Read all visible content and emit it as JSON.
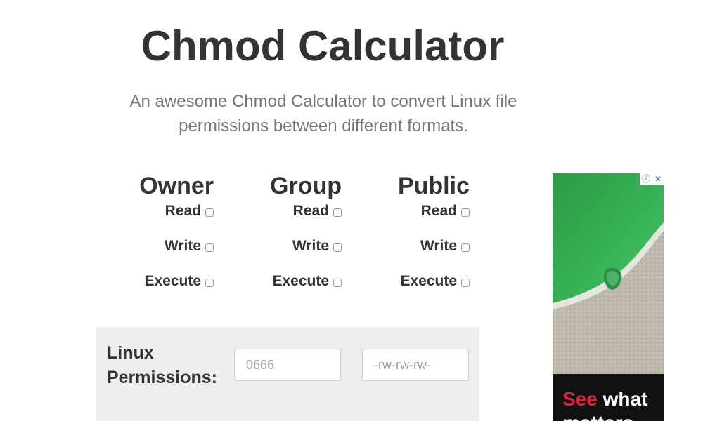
{
  "header": {
    "title": "Chmod Calculator",
    "subtitle": "An awesome Chmod Calculator to convert Linux file permissions between different formats."
  },
  "permissions": {
    "columns": [
      {
        "heading": "Owner",
        "rows": [
          {
            "label": "Read",
            "checked": false
          },
          {
            "label": "Write",
            "checked": false
          },
          {
            "label": "Execute",
            "checked": false
          }
        ]
      },
      {
        "heading": "Group",
        "rows": [
          {
            "label": "Read",
            "checked": false
          },
          {
            "label": "Write",
            "checked": false
          },
          {
            "label": "Execute",
            "checked": false
          }
        ]
      },
      {
        "heading": "Public",
        "rows": [
          {
            "label": "Read",
            "checked": false
          },
          {
            "label": "Write",
            "checked": false
          },
          {
            "label": "Execute",
            "checked": false
          }
        ]
      }
    ]
  },
  "linux_permissions": {
    "label": "Linux Permissions:",
    "octal_placeholder": "0666",
    "symbolic_placeholder": "-rw-rw-rw-"
  },
  "ad": {
    "info_icon": "info-icon",
    "close_icon": "close-icon",
    "headline_accent": "See",
    "headline_rest": " what matters",
    "colors": {
      "accent": "#e0203a",
      "water": "#2fa84a",
      "shore": "#bdb7ad"
    }
  }
}
